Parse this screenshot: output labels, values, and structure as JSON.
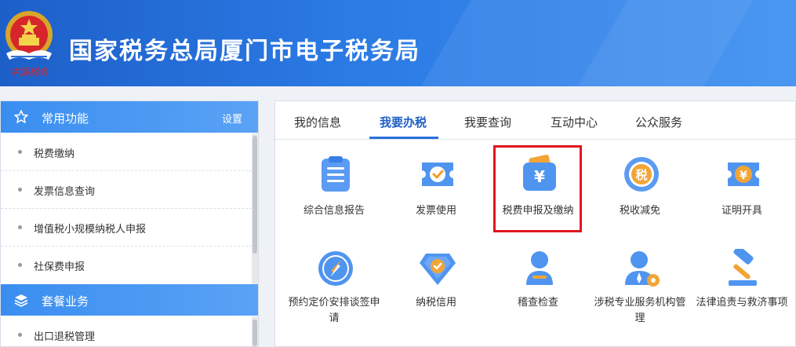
{
  "header": {
    "title": "国家税务总局厦门市电子税务局",
    "emblem_text": "中国税务",
    "colors": {
      "primary": "#2c7be5",
      "accent": "#e0161e"
    }
  },
  "sidebar": {
    "common": {
      "title": "常用功能",
      "settings_label": "设置",
      "icon": "star-icon",
      "items": [
        {
          "label": "税费缴纳"
        },
        {
          "label": "发票信息查询"
        },
        {
          "label": "增值税小规模纳税人申报"
        },
        {
          "label": "社保费申报"
        }
      ]
    },
    "package": {
      "title": "套餐业务",
      "icon": "layers-icon",
      "items": [
        {
          "label": "出口退税管理"
        }
      ]
    }
  },
  "main": {
    "tabs": [
      {
        "label": "我的信息",
        "active": false
      },
      {
        "label": "我要办税",
        "active": true
      },
      {
        "label": "我要查询",
        "active": false
      },
      {
        "label": "互动中心",
        "active": false
      },
      {
        "label": "公众服务",
        "active": false
      }
    ],
    "services": [
      {
        "label": "综合信息报告",
        "icon": "report-clipboard-icon"
      },
      {
        "label": "发票使用",
        "icon": "invoice-ticket-icon"
      },
      {
        "label": "税费申报及缴纳",
        "icon": "yuan-wallet-icon",
        "highlighted": true
      },
      {
        "label": "税收减免",
        "icon": "tax-relief-coin-icon"
      },
      {
        "label": "证明开具",
        "icon": "certificate-yuan-icon"
      },
      {
        "label": "预约定价安排谈签申请",
        "icon": "compass-icon"
      },
      {
        "label": "纳税信用",
        "icon": "diamond-check-icon"
      },
      {
        "label": "稽查检查",
        "icon": "inspector-person-icon"
      },
      {
        "label": "涉税专业服务机构管理",
        "icon": "agent-gear-icon"
      },
      {
        "label": "法律追责与救济事项",
        "icon": "gavel-icon"
      }
    ]
  }
}
